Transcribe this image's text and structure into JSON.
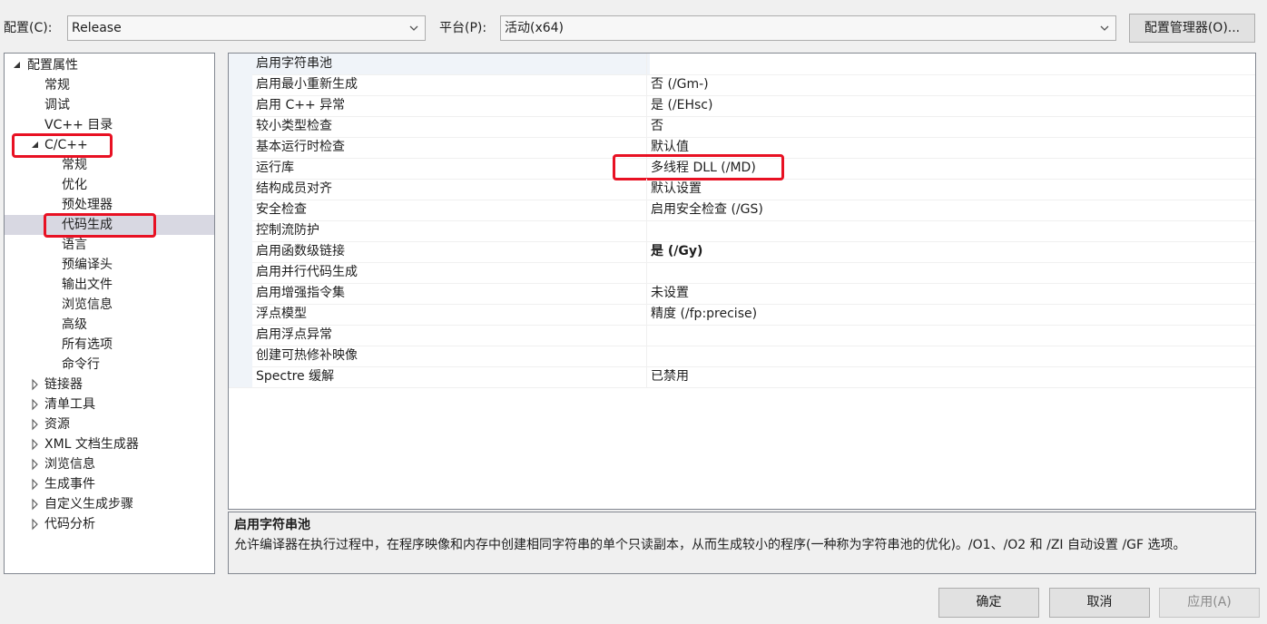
{
  "toolbar": {
    "config_label": "配置(C):",
    "config_value": "Release",
    "platform_label": "平台(P):",
    "platform_value": "活动(x64)",
    "config_manager_button": "配置管理器(O)..."
  },
  "tree": {
    "items": [
      {
        "label": "配置属性",
        "level": 0,
        "toggle": "expanded"
      },
      {
        "label": "常规",
        "level": 1,
        "toggle": "none"
      },
      {
        "label": "调试",
        "level": 1,
        "toggle": "none"
      },
      {
        "label": "VC++ 目录",
        "level": 1,
        "toggle": "none"
      },
      {
        "label": "C/C++",
        "level": 1,
        "toggle": "expanded",
        "highlight": true
      },
      {
        "label": "常规",
        "level": 2,
        "toggle": "none"
      },
      {
        "label": "优化",
        "level": 2,
        "toggle": "none"
      },
      {
        "label": "预处理器",
        "level": 2,
        "toggle": "none"
      },
      {
        "label": "代码生成",
        "level": 2,
        "toggle": "none",
        "selected": true,
        "highlight": true
      },
      {
        "label": "语言",
        "level": 2,
        "toggle": "none"
      },
      {
        "label": "预编译头",
        "level": 2,
        "toggle": "none"
      },
      {
        "label": "输出文件",
        "level": 2,
        "toggle": "none"
      },
      {
        "label": "浏览信息",
        "level": 2,
        "toggle": "none"
      },
      {
        "label": "高级",
        "level": 2,
        "toggle": "none"
      },
      {
        "label": "所有选项",
        "level": 2,
        "toggle": "none"
      },
      {
        "label": "命令行",
        "level": 2,
        "toggle": "none"
      },
      {
        "label": "链接器",
        "level": 1,
        "toggle": "collapsed"
      },
      {
        "label": "清单工具",
        "level": 1,
        "toggle": "collapsed"
      },
      {
        "label": "资源",
        "level": 1,
        "toggle": "collapsed"
      },
      {
        "label": "XML 文档生成器",
        "level": 1,
        "toggle": "collapsed"
      },
      {
        "label": "浏览信息",
        "level": 1,
        "toggle": "collapsed"
      },
      {
        "label": "生成事件",
        "level": 1,
        "toggle": "collapsed"
      },
      {
        "label": "自定义生成步骤",
        "level": 1,
        "toggle": "collapsed"
      },
      {
        "label": "代码分析",
        "level": 1,
        "toggle": "collapsed"
      }
    ]
  },
  "properties": [
    {
      "name": "启用字符串池",
      "value": "",
      "selected": true
    },
    {
      "name": "启用最小重新生成",
      "value": "否 (/Gm-)"
    },
    {
      "name": "启用 C++ 异常",
      "value": "是 (/EHsc)"
    },
    {
      "name": "较小类型检查",
      "value": "否"
    },
    {
      "name": "基本运行时检查",
      "value": "默认值"
    },
    {
      "name": "运行库",
      "value": "多线程 DLL (/MD)",
      "highlight": true
    },
    {
      "name": "结构成员对齐",
      "value": "默认设置"
    },
    {
      "name": "安全检查",
      "value": "启用安全检查 (/GS)"
    },
    {
      "name": "控制流防护",
      "value": ""
    },
    {
      "name": "启用函数级链接",
      "value": "是 (/Gy)",
      "bold": true
    },
    {
      "name": "启用并行代码生成",
      "value": ""
    },
    {
      "name": "启用增强指令集",
      "value": "未设置"
    },
    {
      "name": "浮点模型",
      "value": "精度 (/fp:precise)"
    },
    {
      "name": "启用浮点异常",
      "value": ""
    },
    {
      "name": "创建可热修补映像",
      "value": ""
    },
    {
      "name": "Spectre 缓解",
      "value": "已禁用"
    }
  ],
  "description": {
    "title": "启用字符串池",
    "text": "允许编译器在执行过程中，在程序映像和内存中创建相同字符串的单个只读副本，从而生成较小的程序(一种称为字符串池的优化)。/O1、/O2 和 /ZI 自动设置 /GF 选项。"
  },
  "buttons": {
    "ok": "确定",
    "cancel": "取消",
    "apply": "应用(A)"
  },
  "colors": {
    "annotation_red": "#e81123",
    "selected_tree_bg": "#d8d8e2"
  }
}
